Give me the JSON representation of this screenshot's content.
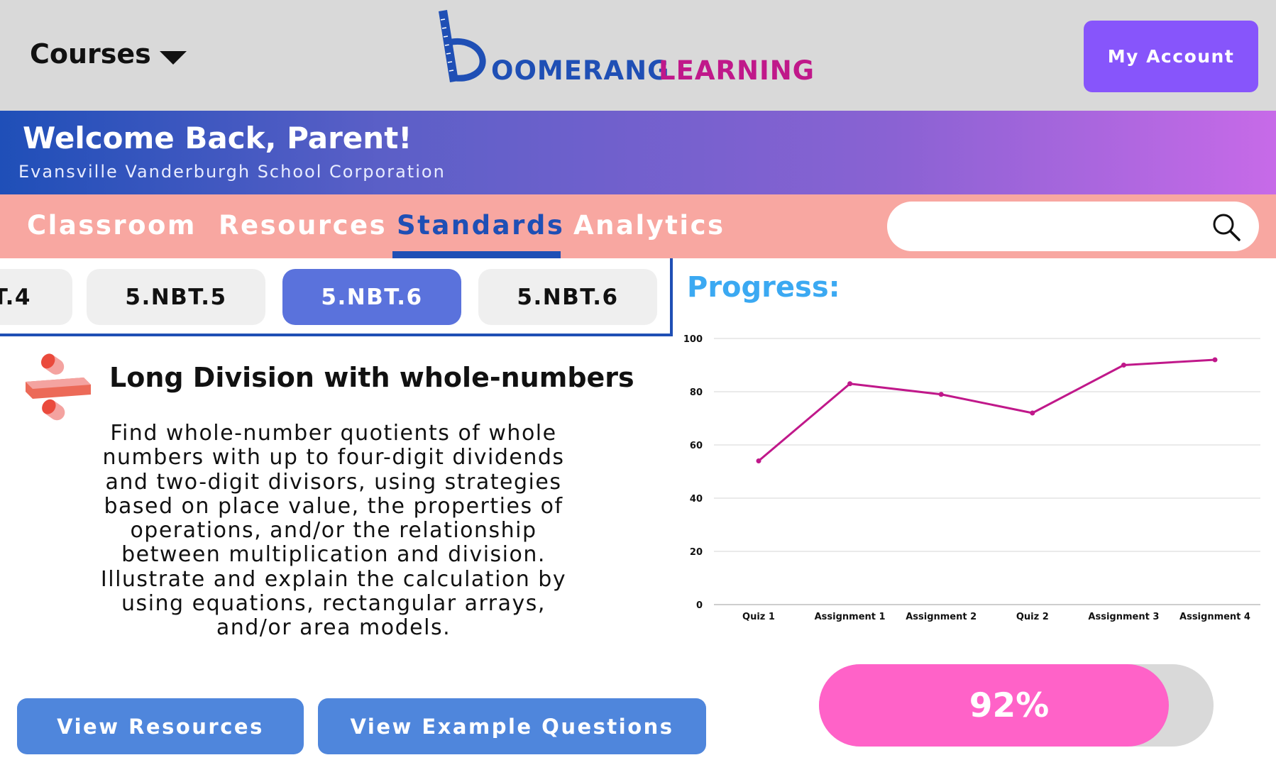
{
  "header": {
    "courses_label": "Courses",
    "logo_word1": "OOMERANG",
    "logo_word2": "LEARNING",
    "account_label": "My Account",
    "colors": {
      "topbar": "#d9d9d9",
      "account": "#8755fb",
      "logo_blue": "#1f4fb5",
      "logo_magenta": "#c0188a"
    }
  },
  "banner": {
    "title": "Welcome Back, Parent!",
    "subtitle": "Evansville Vanderburgh School Corporation"
  },
  "nav": {
    "tabs": [
      {
        "label": "Classroom",
        "active": false
      },
      {
        "label": "Resources",
        "active": false
      },
      {
        "label": "Standards",
        "active": true
      },
      {
        "label": "Analytics",
        "active": false
      }
    ],
    "search_placeholder": "",
    "search_icon": "search-icon"
  },
  "standards": {
    "chips": [
      {
        "label": "T.4",
        "active": false
      },
      {
        "label": "5.NBT.5",
        "active": false
      },
      {
        "label": "5.NBT.6",
        "active": true
      },
      {
        "label": "5.NBT.6",
        "active": false
      }
    ]
  },
  "lesson": {
    "icon": "division-icon",
    "title": "Long Division with whole-numbers",
    "description_lines": [
      "Find whole-number quotients of whole",
      "numbers with up to four-digit dividends",
      "and two-digit divisors, using strategies",
      "based on place value, the properties of",
      "operations, and/or the relationship",
      "between multiplication and division.",
      "Illustrate and explain the calculation by",
      "using equations, rectangular arrays,",
      "and/or area models."
    ],
    "buttons": {
      "view_resources": "View Resources",
      "view_examples": "View Example Questions"
    }
  },
  "progress": {
    "title": "Progress:",
    "overall_label": "92%",
    "overall_value": 0.92
  },
  "chart_data": {
    "type": "line",
    "categories": [
      "Quiz 1",
      "Assignment 1",
      "Assignment 2",
      "Quiz 2",
      "Assignment 3",
      "Assignment 4"
    ],
    "series": [
      {
        "values": [
          54,
          83,
          79,
          72,
          90,
          92
        ],
        "color": "#c0188a"
      }
    ],
    "ylim": [
      0,
      100
    ],
    "yticks": [
      0,
      20,
      40,
      60,
      80,
      100
    ],
    "grid": true,
    "title": "",
    "xlabel": "",
    "ylabel": ""
  }
}
